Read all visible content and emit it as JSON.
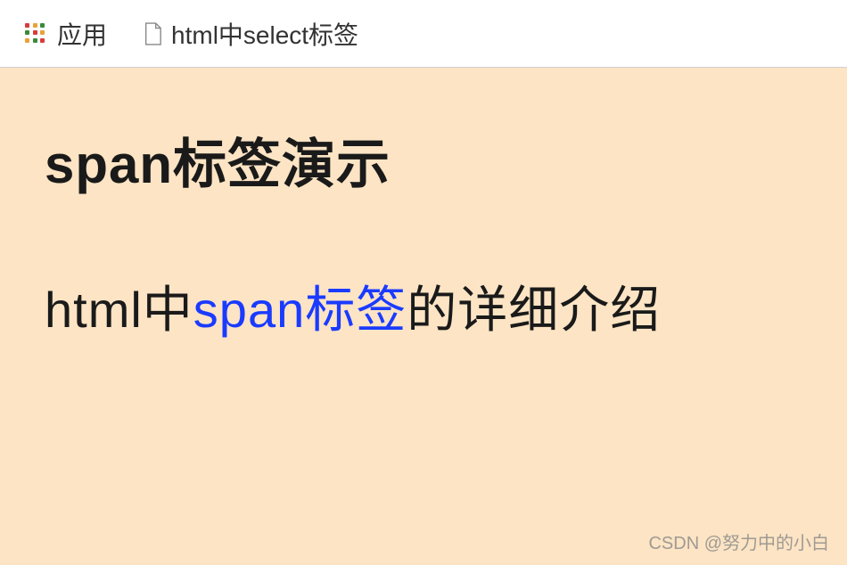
{
  "bookmarkBar": {
    "appsLabel": "应用",
    "bookmarks": [
      {
        "label": "html中select标签"
      }
    ]
  },
  "page": {
    "heading": "span标签演示",
    "paragraph": {
      "before": "html中",
      "highlight": "span标签",
      "after": "的详细介绍"
    }
  },
  "watermark": "CSDN @努力中的小白"
}
